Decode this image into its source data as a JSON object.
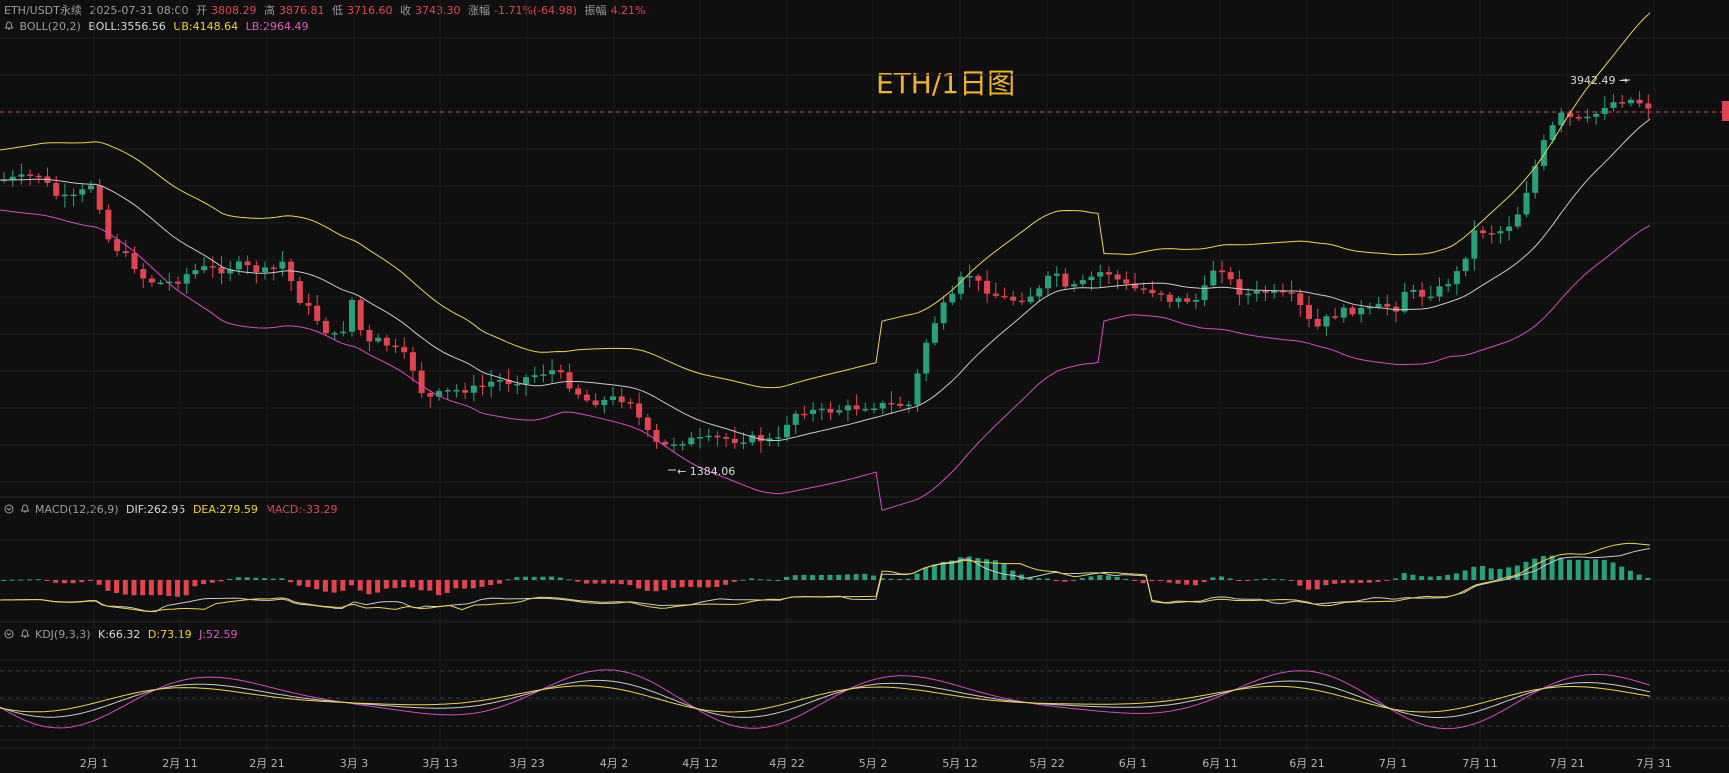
{
  "header": {
    "symbol": "ETH/USDT永续",
    "datetime": "2025-07-31 08:00",
    "open_label": "开",
    "open": "3808.29",
    "high_label": "高",
    "high": "3876.81",
    "low_label": "低",
    "low": "3716.60",
    "close_label": "收",
    "close": "3743.30",
    "change_label": "涨幅",
    "change": "-1.71%(-64.98)",
    "amp_label": "振幅",
    "amp": "4.21%"
  },
  "boll": {
    "name": "BOLL(20,2)",
    "mid": "BOLL:3556.56",
    "ub": "UB:4148.64",
    "lb": "LB:2964.49"
  },
  "macd": {
    "name": "MACD(12,26,9)",
    "dif": "DIF:262.95",
    "dea": "DEA:279.59",
    "macd": "MACD:-33.29"
  },
  "kdj": {
    "name": "KDJ(9,3,3)",
    "k": "K:66.32",
    "d": "D:73.19",
    "j": "J:52.59"
  },
  "title": "ETH/1日图",
  "marks": {
    "high": "3942.49 →",
    "low": "← 1384.06"
  },
  "colors": {
    "up": "#26a17b",
    "down": "#e0454f",
    "mid": "#c8c8c8",
    "ub": "#e8d44d",
    "lb": "#d948c2"
  },
  "chart_data": {
    "type": "candlestick",
    "x_ticks": [
      "2月 1",
      "2月 11",
      "2月 21",
      "3月 3",
      "3月 13",
      "3月 23",
      "4月 2",
      "4月 12",
      "4月 22",
      "5月 2",
      "5月 12",
      "5月 22",
      "6月 1",
      "6月 11",
      "6月 21",
      "7月 1",
      "7月 11",
      "7月 21",
      "7月 31"
    ],
    "last_price": 3743.3,
    "period_high": 3942.49,
    "period_low": 1384.06,
    "series": [
      {
        "name": "BOLL(20,2)",
        "mid": 3556.56,
        "ub": 4148.64,
        "lb": 2964.49
      },
      {
        "name": "MACD(12,26,9)",
        "dif": 262.95,
        "dea": 279.59,
        "macd": -33.29
      },
      {
        "name": "KDJ(9,3,3)",
        "k": 66.32,
        "d": 73.19,
        "j": 52.59
      }
    ]
  }
}
